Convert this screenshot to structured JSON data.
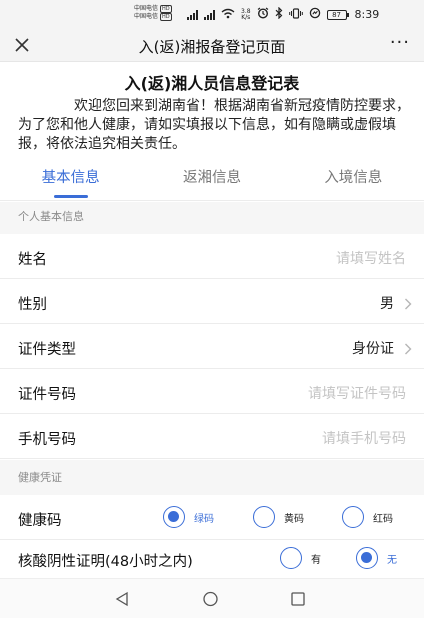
{
  "status_bar": {
    "carrier_1": "中国电信",
    "carrier_2": "中国电信",
    "hd_badge": "HD",
    "net_speed_value": "3.8",
    "net_speed_unit": "K/s",
    "battery": "87",
    "time": "8:39",
    "icons": [
      "signal-icon",
      "wifi-icon",
      "alarm-icon",
      "bluetooth-icon",
      "vibrate-icon",
      "battery-icon"
    ]
  },
  "nav": {
    "title": "入(返)湘报备登记页面",
    "more": "···",
    "close_icon": "close-icon"
  },
  "form": {
    "title": "入(返)湘人员信息登记表",
    "intro": "欢迎您回来到湖南省！根据湖南省新冠疫情防控要求，为了您和他人健康，请如实填报以下信息，如有隐瞒或虚假填报，将依法追究相关责任。"
  },
  "tabs": [
    {
      "label": "基本信息",
      "active": true
    },
    {
      "label": "返湘信息",
      "active": false
    },
    {
      "label": "入境信息",
      "active": false
    }
  ],
  "sections": {
    "personal": "个人基本信息",
    "health": "健康凭证"
  },
  "fields": {
    "name": {
      "label": "姓名",
      "placeholder": "请填写姓名"
    },
    "gender": {
      "label": "性别",
      "value": "男"
    },
    "id_type": {
      "label": "证件类型",
      "value": "身份证"
    },
    "id_number": {
      "label": "证件号码",
      "placeholder": "请填写证件号码"
    },
    "phone": {
      "label": "手机号码",
      "placeholder": "请填手机号码"
    }
  },
  "health_code": {
    "label": "健康码",
    "options": [
      "绿码",
      "黄码",
      "红码"
    ],
    "selected": "绿码"
  },
  "nucleic": {
    "label": "核酸阴性证明(48小时之内)",
    "options": [
      "有",
      "无"
    ],
    "selected": "无"
  },
  "theme": {
    "accent": "#3a6dd7"
  }
}
